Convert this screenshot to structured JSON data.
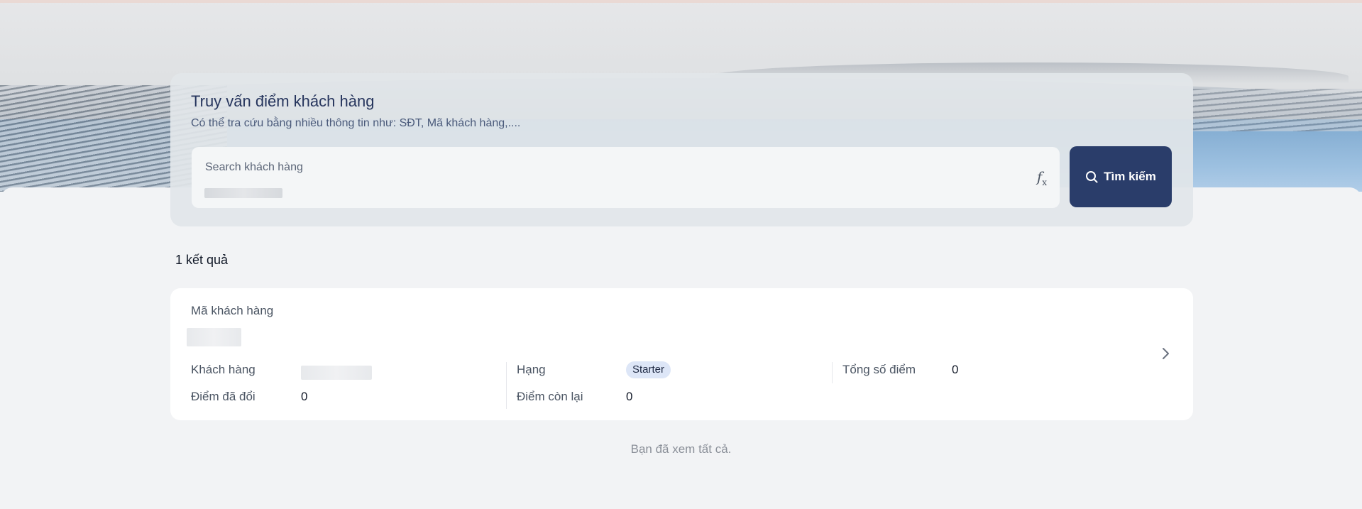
{
  "search": {
    "title": "Truy vấn điểm khách hàng",
    "subtitle": "Có thể tra cứu bằng nhiều thông tin như: SĐT, Mã khách hàng,....",
    "placeholder": "Search khách hàng",
    "formula_icon": "function-icon",
    "button_label": "Tìm kiếm",
    "button_icon": "search-icon"
  },
  "results": {
    "count_label": "1 kết quả",
    "items": [
      {
        "code_label": "Mã khách hàng",
        "customer_label": "Khách hàng",
        "rank_label": "Hạng",
        "rank_value": "Starter",
        "total_points_label": "Tổng số điểm",
        "total_points_value": "0",
        "redeemed_label": "Điểm đã đổi",
        "redeemed_value": "0",
        "remaining_label": "Điểm còn lại",
        "remaining_value": "0"
      }
    ],
    "end_note": "Bạn đã xem tất cả."
  },
  "colors": {
    "primary": "#2a3d6a",
    "badge_bg": "#dde6f7",
    "title_text": "#26355d"
  }
}
